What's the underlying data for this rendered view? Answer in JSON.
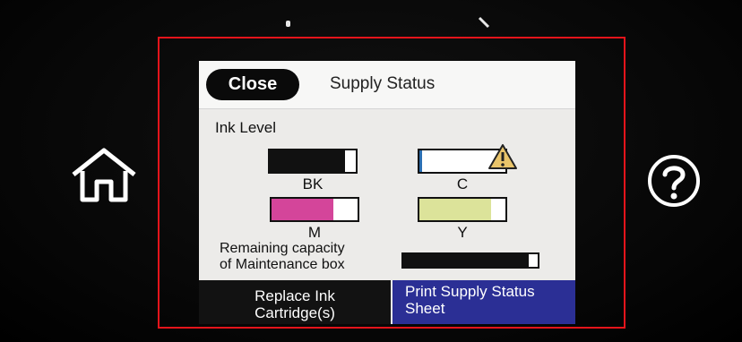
{
  "header": {
    "close_label": "Close",
    "title": "Supply Status"
  },
  "ink_section": {
    "label": "Ink Level",
    "cartridges": [
      {
        "name": "BK",
        "level": 0.87,
        "color": "#111111",
        "warning": false
      },
      {
        "name": "C",
        "level": 0.03,
        "color": "#2b6fb3",
        "warning": true
      },
      {
        "name": "M",
        "level": 0.72,
        "color": "#d4459a",
        "warning": false
      },
      {
        "name": "Y",
        "level": 0.83,
        "color": "#dce39a",
        "warning": false
      }
    ],
    "warning_icon": "warning-triangle-icon"
  },
  "maintenance": {
    "label_line1": "Remaining capacity",
    "label_line2": "of Maintenance box",
    "level": 0.93
  },
  "actions": {
    "replace_line1": "Replace Ink",
    "replace_line2": "Cartridge(s)",
    "print_line1": "Print Supply Status",
    "print_line2": "Sheet"
  },
  "hardware": {
    "home_icon": "home-icon",
    "help_icon": "question-mark-icon"
  },
  "colors": {
    "frame": "#e4141b",
    "print_button": "#2b2f95",
    "close_button": "#0a0a0a"
  }
}
